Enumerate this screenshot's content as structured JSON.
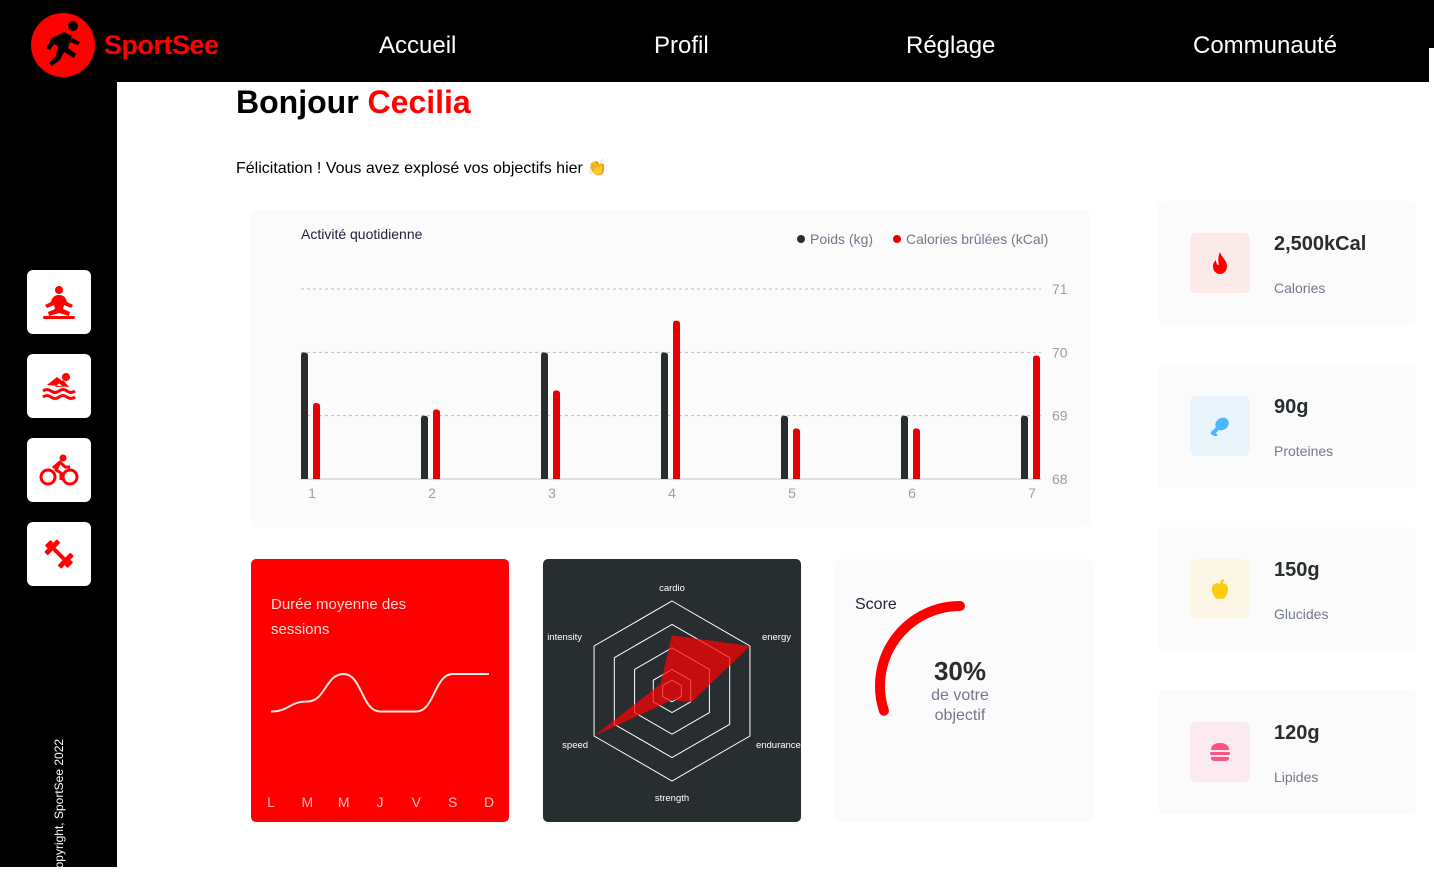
{
  "brand": {
    "name": "SportSee",
    "accent": "#ff0101"
  },
  "nav": [
    {
      "label": "Accueil"
    },
    {
      "label": "Profil"
    },
    {
      "label": "Réglage"
    },
    {
      "label": "Communauté"
    }
  ],
  "sidebar": {
    "items": [
      {
        "icon": "yoga-icon"
      },
      {
        "icon": "swimming-icon"
      },
      {
        "icon": "cycling-icon"
      },
      {
        "icon": "dumbbell-icon"
      }
    ],
    "copyright": "Copyright, SportSee 2022"
  },
  "greeting": {
    "prefix": "Bonjour",
    "name": "Cecilia",
    "message": "Félicitation ! Vous avez explosé vos objectifs hier 👏"
  },
  "chart_data": [
    {
      "type": "bar",
      "title": "Activité quotidienne",
      "categories": [
        "1",
        "2",
        "3",
        "4",
        "5",
        "6",
        "7"
      ],
      "y_ticks": [
        "68",
        "69",
        "70",
        "71"
      ],
      "ylim": [
        68,
        71
      ],
      "series": [
        {
          "name": "Poids (kg)",
          "color": "#282d30",
          "values": [
            70,
            69,
            70,
            70,
            69,
            69,
            69
          ]
        },
        {
          "name": "Calories brûlées (kCal)",
          "color": "#e60000",
          "values": [
            69.2,
            69.1,
            69.4,
            70.5,
            68.8,
            68.8,
            69.95
          ]
        }
      ],
      "grid": true,
      "legend": "top-right"
    },
    {
      "type": "line",
      "title": "Durée moyenne des sessions",
      "categories": [
        "L",
        "M",
        "M",
        "J",
        "V",
        "S",
        "D"
      ],
      "values": [
        30,
        38,
        60,
        30,
        30,
        60,
        60
      ],
      "ylim": [
        0,
        80
      ]
    },
    {
      "type": "radar",
      "axes": [
        "cardio",
        "energy",
        "endurance",
        "strength",
        "speed",
        "intensity"
      ],
      "values": [
        0.62,
        1.0,
        0.25,
        0.1,
        1.0,
        0.15
      ],
      "max": 1
    },
    {
      "type": "radial",
      "title": "Score",
      "value": 0.3,
      "label_value": "30%",
      "label_line1": "de votre",
      "label_line2": "objectif"
    }
  ],
  "nutrition": [
    {
      "value": "2,500kCal",
      "label": "Calories",
      "icon": "flame-icon",
      "bg": "#fbeaea",
      "color": "#ff0000"
    },
    {
      "value": "90g",
      "label": "Proteines",
      "icon": "chicken-icon",
      "bg": "#e9f4fb",
      "color": "#4ab8ff"
    },
    {
      "value": "150g",
      "label": "Glucides",
      "icon": "apple-icon",
      "bg": "#fbf6e5",
      "color": "#fdcc0c"
    },
    {
      "value": "120g",
      "label": "Lipides",
      "icon": "burger-icon",
      "bg": "#fbeaef",
      "color": "#fd5181"
    }
  ]
}
